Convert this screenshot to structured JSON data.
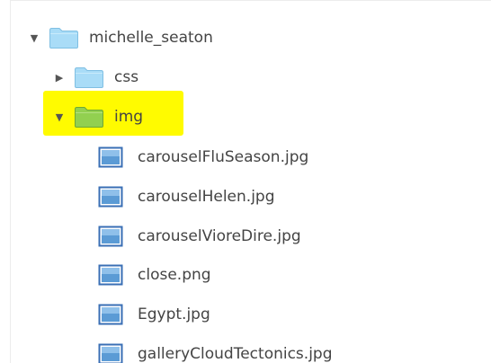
{
  "tree": {
    "root": {
      "label": "michelle_seaton",
      "expanded": true
    },
    "folders": [
      {
        "label": "css",
        "expanded": false
      },
      {
        "label": "img",
        "expanded": true,
        "highlighted": true
      }
    ],
    "files": [
      {
        "label": "carouselFluSeason.jpg"
      },
      {
        "label": "carouselHelen.jpg"
      },
      {
        "label": "carouselVioreDire.jpg"
      },
      {
        "label": "close.png"
      },
      {
        "label": "Egypt.jpg"
      },
      {
        "label": "galleryCloudTectonics.jpg"
      }
    ],
    "glyphs": {
      "expanded": "▼",
      "collapsed": "▶"
    }
  },
  "colors": {
    "folder_blue": "#a9dcf7",
    "folder_green": "#92d050",
    "highlight": "#fffb00"
  }
}
